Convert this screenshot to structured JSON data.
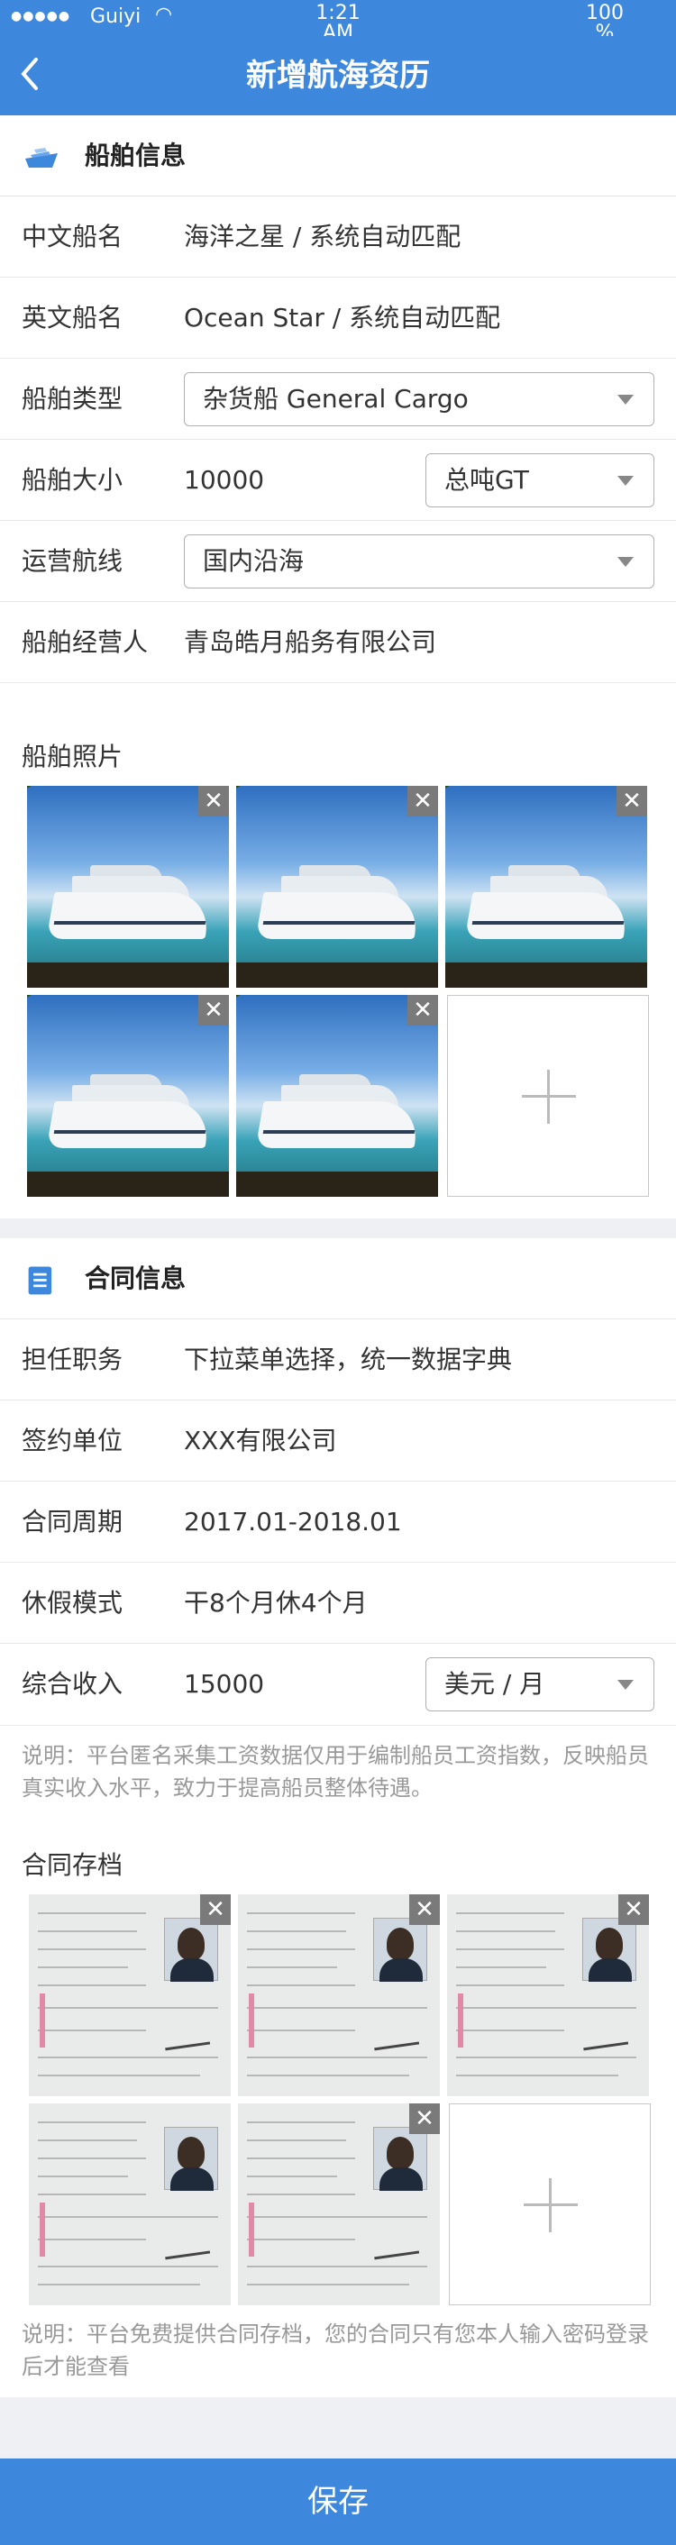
{
  "status_bar": {
    "carrier": "Guiyi",
    "time": "1:21\nAM",
    "battery": "100\n%"
  },
  "nav": {
    "title": "新增航海资历"
  },
  "ship_section": {
    "title": "船舶信息",
    "rows": {
      "cn_name": {
        "label": "中文船名",
        "value": "海洋之星 / 系统自动匹配"
      },
      "en_name": {
        "label": "英文船名",
        "value": "Ocean Star / 系统自动匹配"
      },
      "type": {
        "label": "船舶类型",
        "value": "杂货船 General Cargo"
      },
      "size": {
        "label": "船舶大小",
        "value": "10000",
        "unit": "总吨GT"
      },
      "route": {
        "label": "运营航线",
        "value": "国内沿海"
      },
      "operator": {
        "label": "船舶经营人",
        "value": "青岛皓月船务有限公司"
      }
    },
    "photos_label": "船舶照片"
  },
  "contract_section": {
    "title": "合同信息",
    "rows": {
      "position": {
        "label": "担任职务",
        "value": "下拉菜单选择，统一数据字典"
      },
      "company": {
        "label": "签约单位",
        "value": "XXX有限公司"
      },
      "period": {
        "label": "合同周期",
        "value": "2017.01-2018.01"
      },
      "leave": {
        "label": "休假模式",
        "value": "干8个月休4个月"
      },
      "income": {
        "label": "综合收入",
        "value": "15000",
        "unit": "美元 / 月"
      }
    },
    "income_note": "说明：平台匿名采集工资数据仅用于编制船员工资指数，反映船员真实收入水平，致力于提高船员整体待遇。",
    "archive_label": "合同存档",
    "archive_note": "说明：平台免费提供合同存档，您的合同只有您本人输入密码登录后才能查看"
  },
  "icons": {
    "close": "close-icon",
    "add": "plus-icon",
    "back": "chevron-left-icon",
    "ship": "ship-icon",
    "doc": "document-icon"
  },
  "close_glyph": "✕",
  "save_label": "保存",
  "colors": {
    "primary": "#3d87dc",
    "divider": "#eff0f3"
  }
}
